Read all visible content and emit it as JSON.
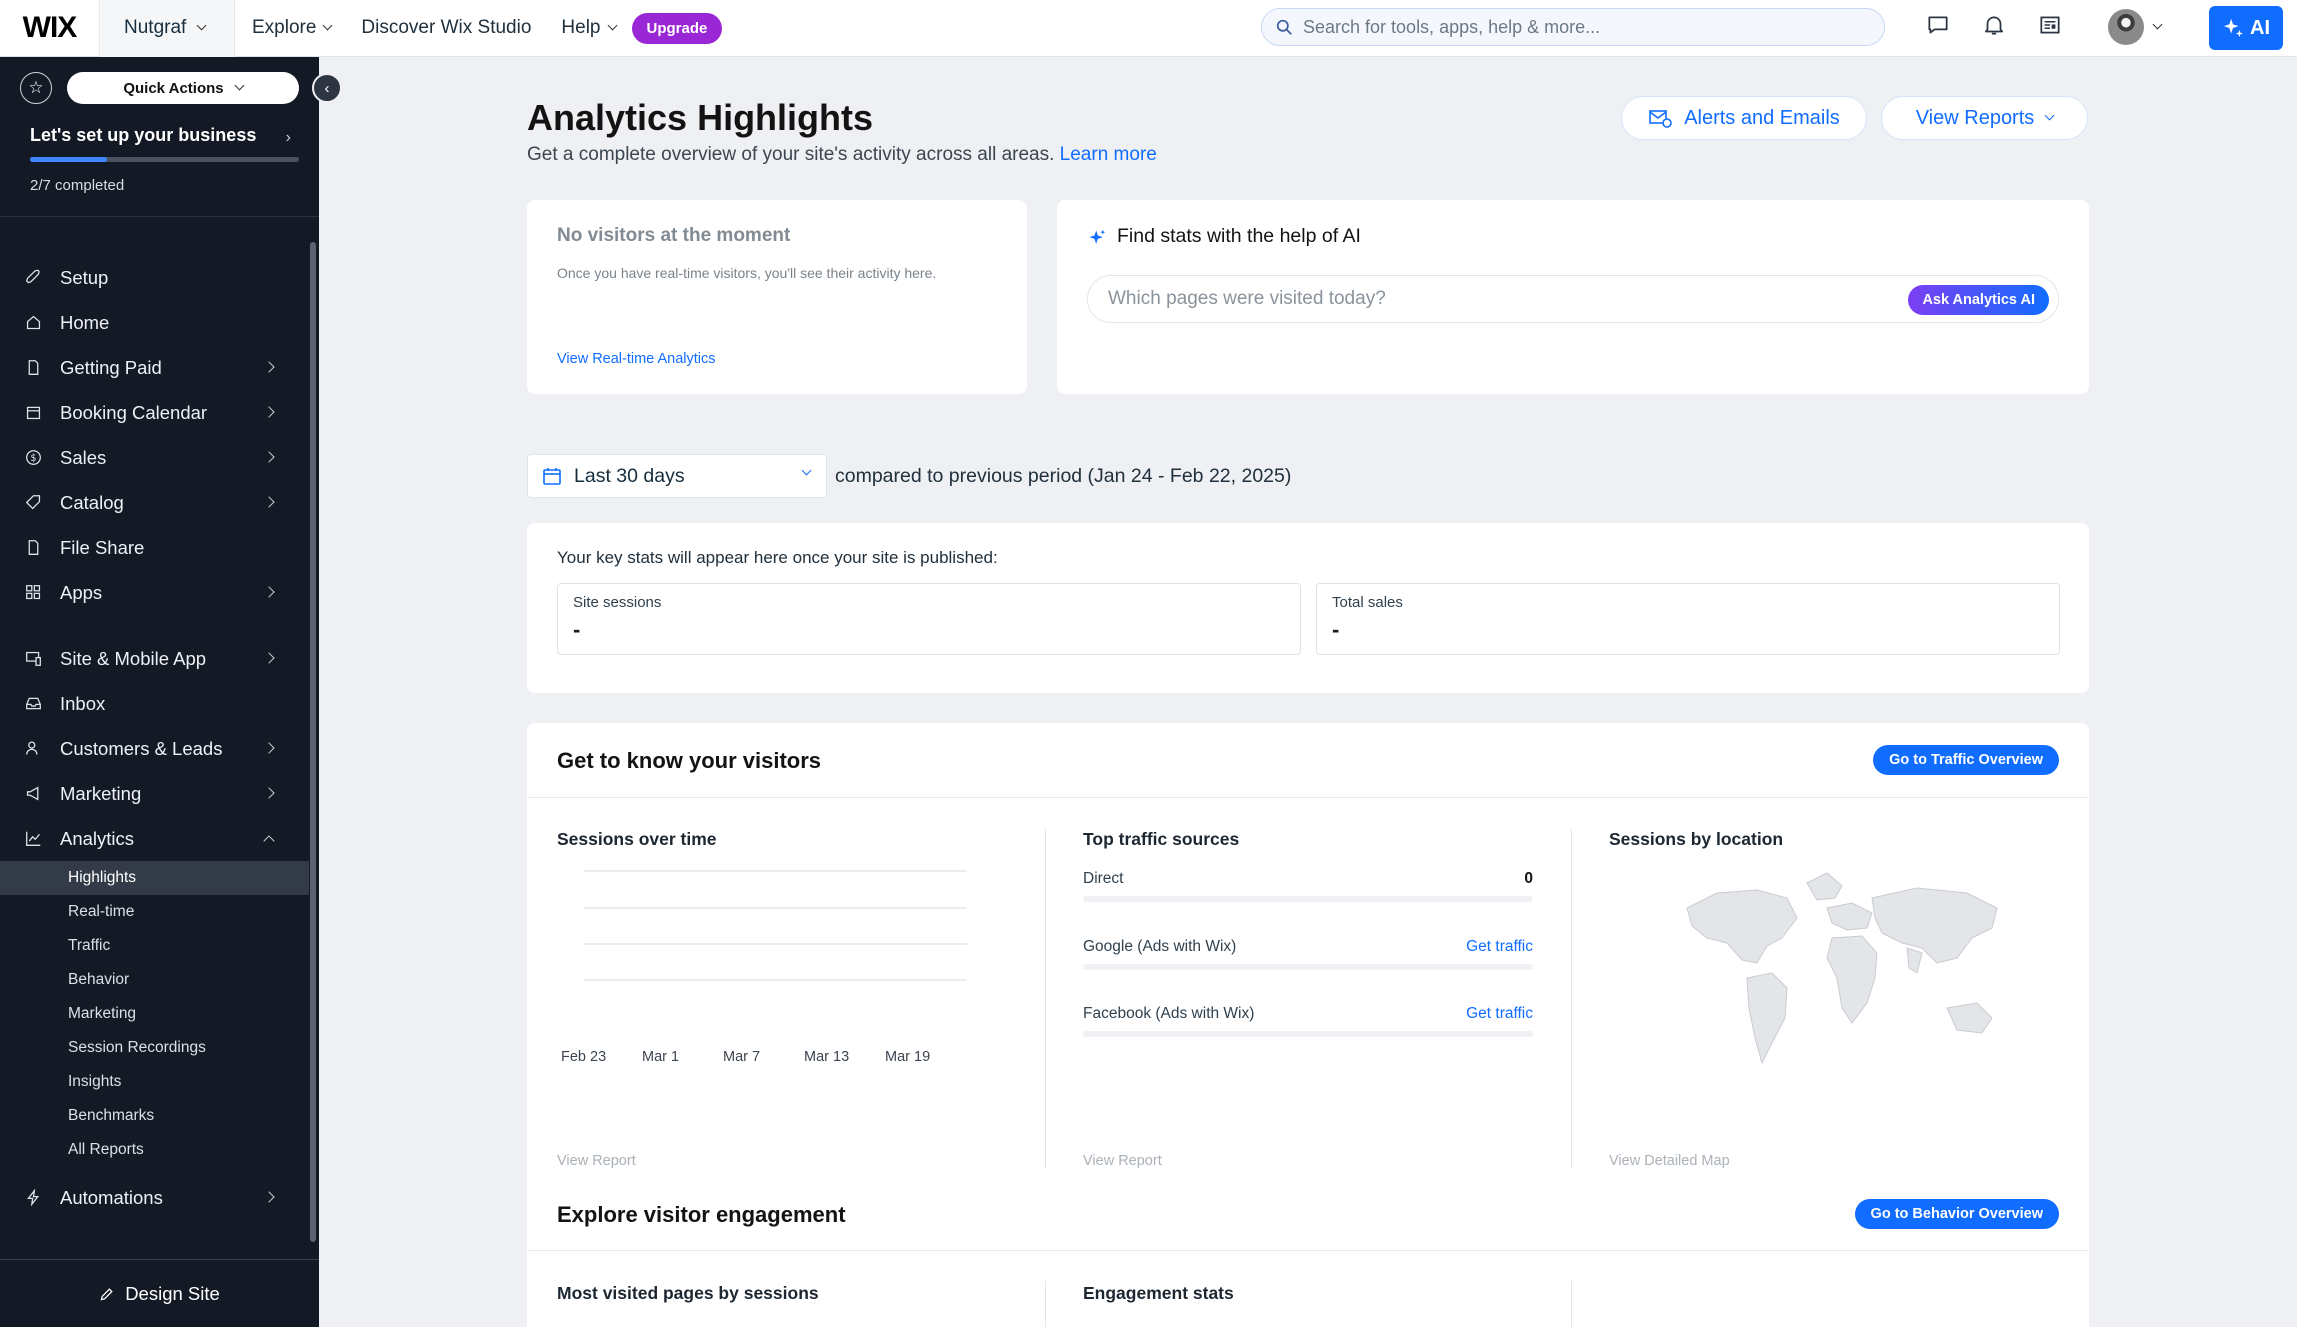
{
  "topbar": {
    "logo": "WIX",
    "site_name": "Nutgraf",
    "nav": {
      "explore": "Explore",
      "discover": "Discover Wix Studio",
      "help": "Help"
    },
    "upgrade": "Upgrade",
    "search_placeholder": "Search for tools, apps, help & more...",
    "ai_label": "AI"
  },
  "sidebar": {
    "quick_actions": "Quick Actions",
    "setup_title": "Let's set up your business",
    "setup_progress_fraction": 0.2857,
    "setup_count": "2/7 completed",
    "items": {
      "setup": "Setup",
      "home": "Home",
      "getting_paid": "Getting Paid",
      "booking_calendar": "Booking Calendar",
      "sales": "Sales",
      "catalog": "Catalog",
      "file_share": "File Share",
      "apps": "Apps",
      "site_mobile": "Site & Mobile App",
      "inbox": "Inbox",
      "customers": "Customers & Leads",
      "marketing": "Marketing",
      "analytics": "Analytics",
      "automations": "Automations"
    },
    "analytics_sub": [
      "Highlights",
      "Real-time",
      "Traffic",
      "Behavior",
      "Marketing",
      "Session Recordings",
      "Insights",
      "Benchmarks",
      "All Reports"
    ],
    "footer": "Design Site"
  },
  "main": {
    "title": "Analytics Highlights",
    "subtitle": "Get a complete overview of your site's activity across all areas.",
    "learn_more": "Learn more",
    "alerts_btn": "Alerts and Emails",
    "reports_btn": "View Reports",
    "realtime": {
      "title": "No visitors at the moment",
      "desc": "Once you have real-time visitors, you'll see their activity here.",
      "link": "View Real-time Analytics"
    },
    "ai": {
      "title": "Find stats with the help of AI",
      "placeholder": "Which pages were visited today?",
      "button": "Ask Analytics AI"
    },
    "date_range": "Last 30 days",
    "compare_text": "compared to previous period (Jan 24 - Feb 22, 2025)",
    "key_stats": {
      "intro": "Your key stats will appear here once your site is published:",
      "sessions_label": "Site sessions",
      "sessions_value": "-",
      "sales_label": "Total sales",
      "sales_value": "-"
    },
    "visitors": {
      "title": "Get to know your visitors",
      "button": "Go to Traffic Overview",
      "sessions_title": "Sessions over time",
      "x_ticks": [
        "Feb 23",
        "Mar 1",
        "Mar 7",
        "Mar 13",
        "Mar 19"
      ],
      "view_report": "View Report",
      "traffic_title": "Top traffic sources",
      "sources": [
        {
          "name": "Direct",
          "value": "0"
        },
        {
          "name": "Google (Ads with Wix)",
          "value": "Get traffic"
        },
        {
          "name": "Facebook (Ads with Wix)",
          "value": "Get traffic"
        }
      ],
      "traffic_report": "View Report",
      "location_title": "Sessions by location",
      "map_link": "View Detailed Map"
    },
    "engagement": {
      "title": "Explore visitor engagement",
      "button": "Go to Behavior Overview",
      "col1": "Most visited pages by sessions",
      "col2": "Engagement stats"
    }
  },
  "colors": {
    "accent": "#116dff",
    "upgrade": "#9a27d5",
    "sidebar_bg": "#131925",
    "page_bg": "#eef0f3"
  }
}
